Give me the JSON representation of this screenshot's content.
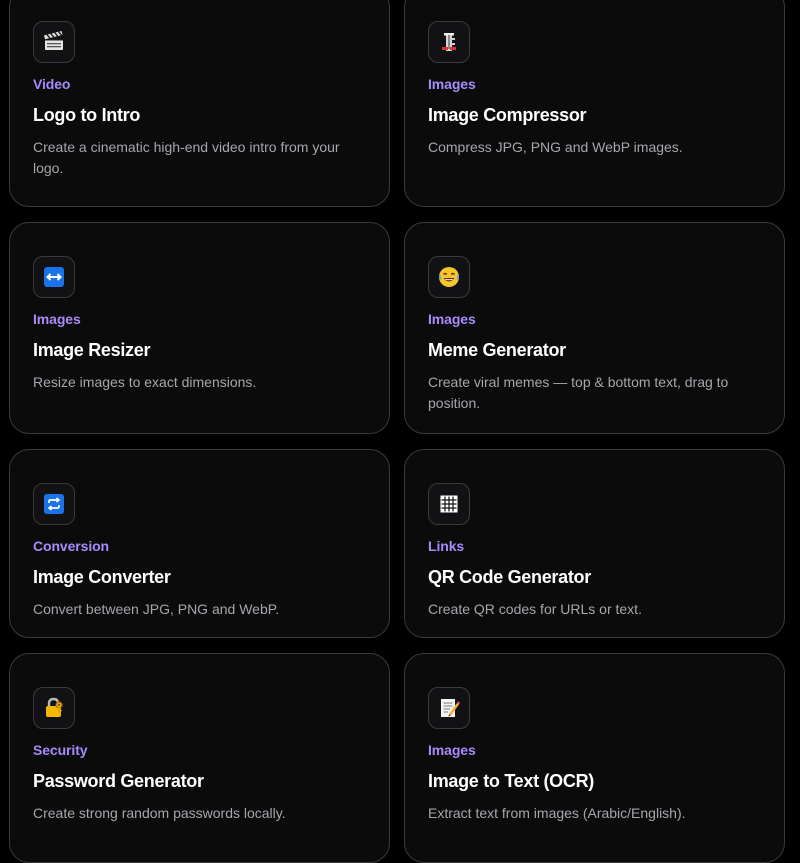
{
  "tools": [
    {
      "category": "Video",
      "title": "Logo to Intro",
      "description": "Create a cinematic high-end video intro from your logo.",
      "icon": "clapperboard-icon"
    },
    {
      "category": "Images",
      "title": "Image Compressor",
      "description": "Compress JPG, PNG and WebP images.",
      "icon": "clamp-icon"
    },
    {
      "category": "Images",
      "title": "Image Resizer",
      "description": "Resize images to exact dimensions.",
      "icon": "left-right-arrow-icon"
    },
    {
      "category": "Images",
      "title": "Meme Generator",
      "description": "Create viral memes — top & bottom text, drag to position.",
      "icon": "laughing-face-icon"
    },
    {
      "category": "Conversion",
      "title": "Image Converter",
      "description": "Convert between JPG, PNG and WebP.",
      "icon": "repeat-arrows-icon"
    },
    {
      "category": "Links",
      "title": "QR Code Generator",
      "description": "Create QR codes for URLs or text.",
      "icon": "grid-icon"
    },
    {
      "category": "Security",
      "title": "Password Generator",
      "description": "Create strong random passwords locally.",
      "icon": "lock-with-key-icon"
    },
    {
      "category": "Images",
      "title": "Image to Text (OCR)",
      "description": "Extract text from images (Arabic/English).",
      "icon": "memo-icon"
    }
  ],
  "colors": {
    "accent": "#a78bfa",
    "card_bg": "#0b0b0c",
    "card_border": "#3a3a3d",
    "page_bg": "#000000"
  }
}
